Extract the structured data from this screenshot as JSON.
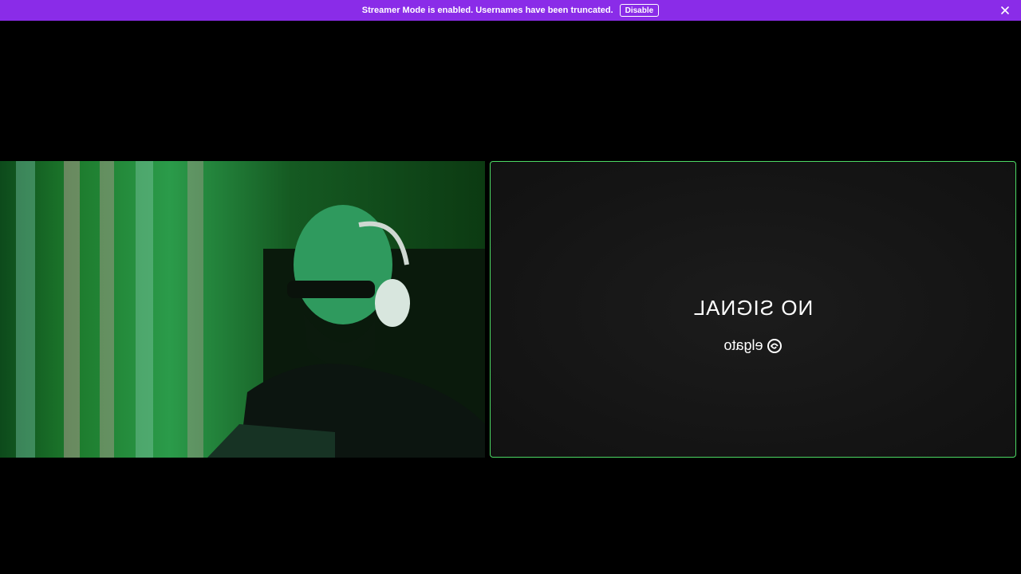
{
  "banner": {
    "message": "Streamer Mode is enabled. Usernames have been truncated.",
    "disable_label": "Disable",
    "background": "#8a2ce8"
  },
  "tiles": [
    {
      "id": "camera-feed",
      "kind": "video"
    },
    {
      "id": "no-signal-feed",
      "kind": "placeholder",
      "text": "NO SIGNAL",
      "brand": "elgato",
      "border_color": "#4cd964"
    }
  ]
}
